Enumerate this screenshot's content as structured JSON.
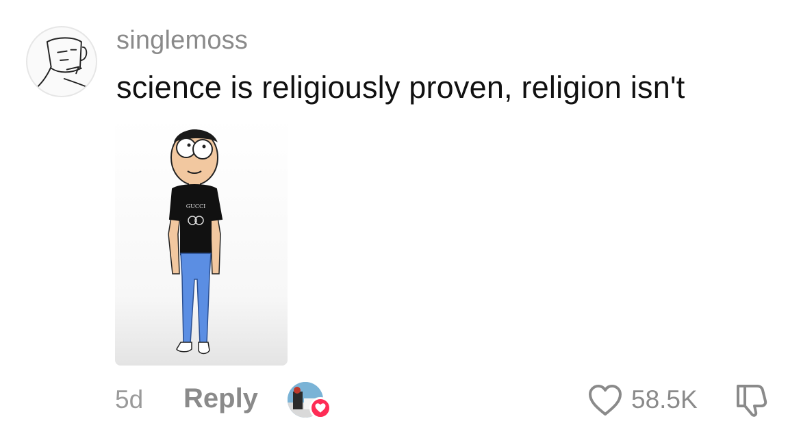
{
  "comment": {
    "username": "singlemoss",
    "text": "science is religiously proven, religion isn't",
    "sticker_shirt_text": "GUCCI",
    "timestamp": "5d",
    "reply_label": "Reply",
    "like_count": "58.5K"
  },
  "icons": {
    "avatar": "sketch-face-avatar",
    "sticker": "cartoon-character-sticker",
    "creator_avatar": "creator-avatar",
    "creator_badge": "heart-icon",
    "like": "heart-outline-icon",
    "dislike": "thumbs-down-icon"
  },
  "colors": {
    "username": "#8a8a8a",
    "text": "#111111",
    "meta": "#9a9a9a",
    "creator_heart": "#fe2c55"
  }
}
